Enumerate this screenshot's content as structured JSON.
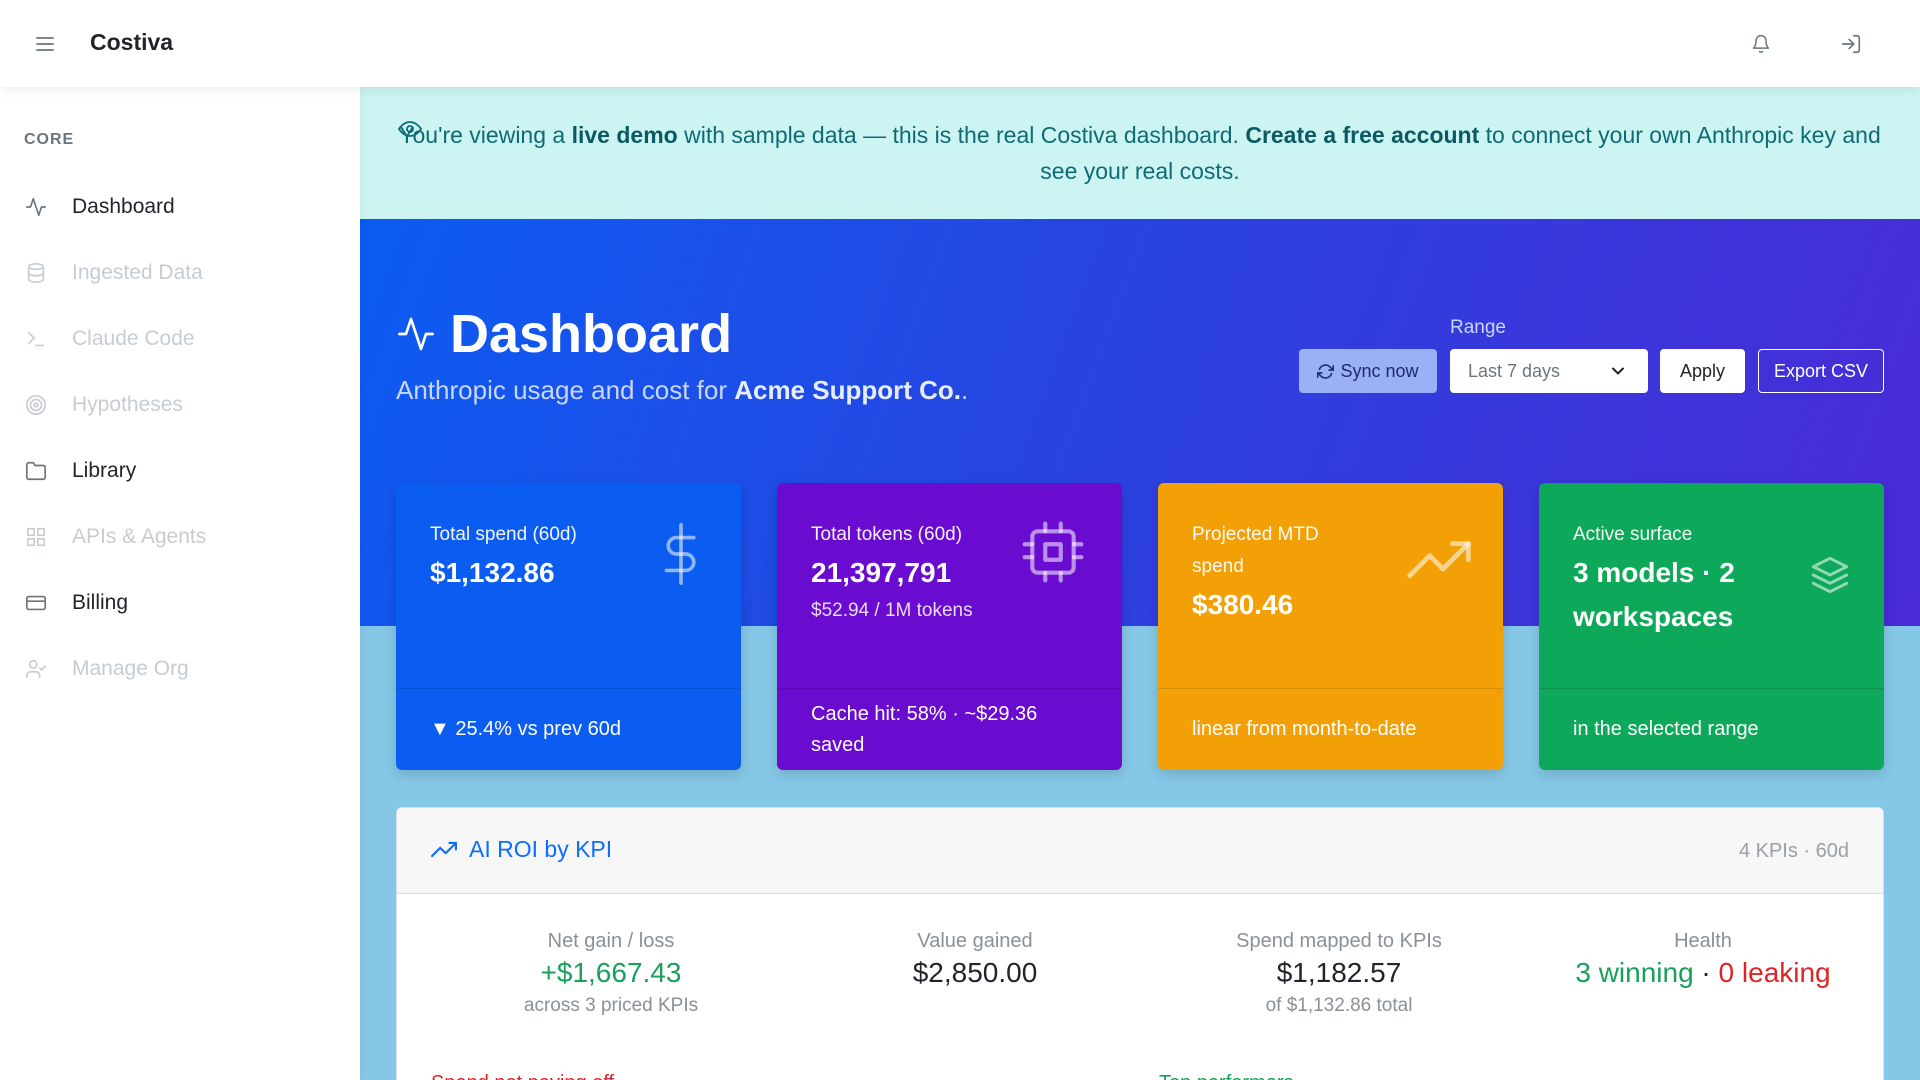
{
  "app": {
    "brand": "Costiva"
  },
  "sidebar": {
    "heading": "CORE",
    "items": [
      {
        "label": "Dashboard",
        "icon": "activity-icon",
        "enabled": true
      },
      {
        "label": "Ingested Data",
        "icon": "database-icon",
        "enabled": false
      },
      {
        "label": "Claude Code",
        "icon": "terminal-icon",
        "enabled": false
      },
      {
        "label": "Hypotheses",
        "icon": "target-icon",
        "enabled": false
      },
      {
        "label": "Library",
        "icon": "folder-icon",
        "enabled": true
      },
      {
        "label": "APIs & Agents",
        "icon": "grid-icon",
        "enabled": false
      },
      {
        "label": "Billing",
        "icon": "credit-card-icon",
        "enabled": true
      },
      {
        "label": "Manage Org",
        "icon": "user-check-icon",
        "enabled": false
      }
    ]
  },
  "banner": {
    "pre": "You're viewing a ",
    "emphasis": "live demo",
    "mid": " with sample data — this is the real Costiva dashboard.  ",
    "cta": "Create a free account",
    "post": " to connect your own Anthropic key and see your real costs."
  },
  "hero": {
    "title": "Dashboard",
    "subtitle_pre": "Anthropic usage and cost for ",
    "subtitle_org": "Acme Support Co.",
    "subtitle_post": ".",
    "range_label": "Range",
    "sync_label": "Sync now",
    "range_value": "Last 7 days",
    "apply_label": "Apply",
    "export_label": "Export CSV"
  },
  "cards": [
    {
      "label": "Total spend (60d)",
      "value": "$1,132.86",
      "sub": "",
      "footer": "▼ 25.4% vs prev 60d",
      "icon": "dollar-icon",
      "color": "#0b5cf0"
    },
    {
      "label": "Total tokens (60d)",
      "value": "21,397,791",
      "sub": "$52.94 / 1M tokens",
      "footer": "Cache hit: 58% · ~$29.36 saved",
      "icon": "cpu-icon",
      "color": "#6a0bd0"
    },
    {
      "label": "Projected MTD spend",
      "value": "$380.46",
      "sub": "",
      "footer": "linear from month-to-date",
      "icon": "trending-up-icon",
      "color": "#f2a005"
    },
    {
      "label": "Active surface",
      "value": "3 models · 2 workspaces",
      "sub": "",
      "footer": "in the selected range",
      "icon": "layers-icon",
      "color": "#0ea85a"
    }
  ],
  "roi": {
    "title": "AI ROI by KPI",
    "meta": "4 KPIs · 60d",
    "metrics": [
      {
        "label": "Net gain / loss",
        "value": "+$1,667.43",
        "sub": "across 3 priced KPIs"
      },
      {
        "label": "Value gained",
        "value": "$2,850.00",
        "sub": ""
      },
      {
        "label": "Spend mapped to KPIs",
        "value": "$1,182.57",
        "sub": "of $1,132.86 total"
      },
      {
        "label": "Health",
        "winning": "3 winning",
        "separator": " · ",
        "leaking": "0 leaking"
      }
    ],
    "section_left": "Spend not paying off",
    "section_right": "Top performers"
  }
}
